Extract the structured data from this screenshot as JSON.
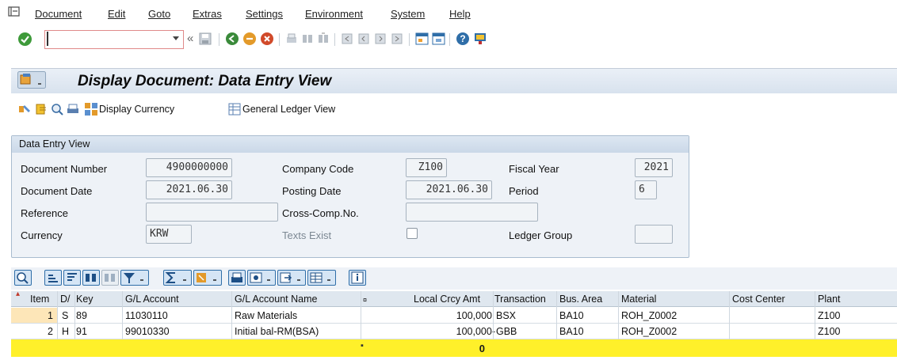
{
  "menubar": {
    "items": [
      "Document",
      "Edit",
      "Goto",
      "Extras",
      "Settings",
      "Environment",
      "System",
      "Help"
    ]
  },
  "toolbar": {
    "command_field_value": "",
    "nav_back_symbol": "«"
  },
  "titlebar": {
    "title": "Display Document: Data Entry View"
  },
  "app_toolbar": {
    "display_currency": "Display Currency",
    "general_ledger_view": "General Ledger View"
  },
  "data_entry": {
    "group_title": "Data Entry View",
    "document_number_label": "Document Number",
    "document_number": "4900000000",
    "company_code_label": "Company Code",
    "company_code": "Z100",
    "fiscal_year_label": "Fiscal Year",
    "fiscal_year": "2021",
    "document_date_label": "Document Date",
    "document_date": "2021.06.30",
    "posting_date_label": "Posting Date",
    "posting_date": "2021.06.30",
    "period_label": "Period",
    "period": "6",
    "reference_label": "Reference",
    "reference": "",
    "cross_comp_label": "Cross-Comp.No.",
    "cross_comp": "",
    "currency_label": "Currency",
    "currency": "KRW",
    "texts_exist_label": "Texts Exist",
    "ledger_group_label": "Ledger Group",
    "ledger_group": ""
  },
  "grid": {
    "headers": {
      "item": "Item",
      "dc": "D/",
      "key": "Key",
      "gl_account": "G/L Account",
      "gl_name": "G/L Account Name",
      "sigma": "¤",
      "amount": "Local Crcy Amt",
      "transaction": "Transaction",
      "bus_area": "Bus. Area",
      "material": "Material",
      "cost_center": "Cost Center",
      "plant": "Plant"
    },
    "rows": [
      {
        "item": "1",
        "dc": "S",
        "key": "89",
        "gl_account": "11030110",
        "gl_name": "Raw Materials",
        "amount": "100,000",
        "transaction": "BSX",
        "bus_area": "BA10",
        "material": "ROH_Z0002",
        "cost_center": "",
        "plant": "Z100"
      },
      {
        "item": "2",
        "dc": "H",
        "key": "91",
        "gl_account": "99010330",
        "gl_name": "Initial bal-RM(BSA)",
        "amount": "100,000-",
        "transaction": "GBB",
        "bus_area": "BA10",
        "material": "ROH_Z0002",
        "cost_center": "",
        "plant": "Z100"
      }
    ],
    "total_marker": "▪",
    "total": "0"
  }
}
